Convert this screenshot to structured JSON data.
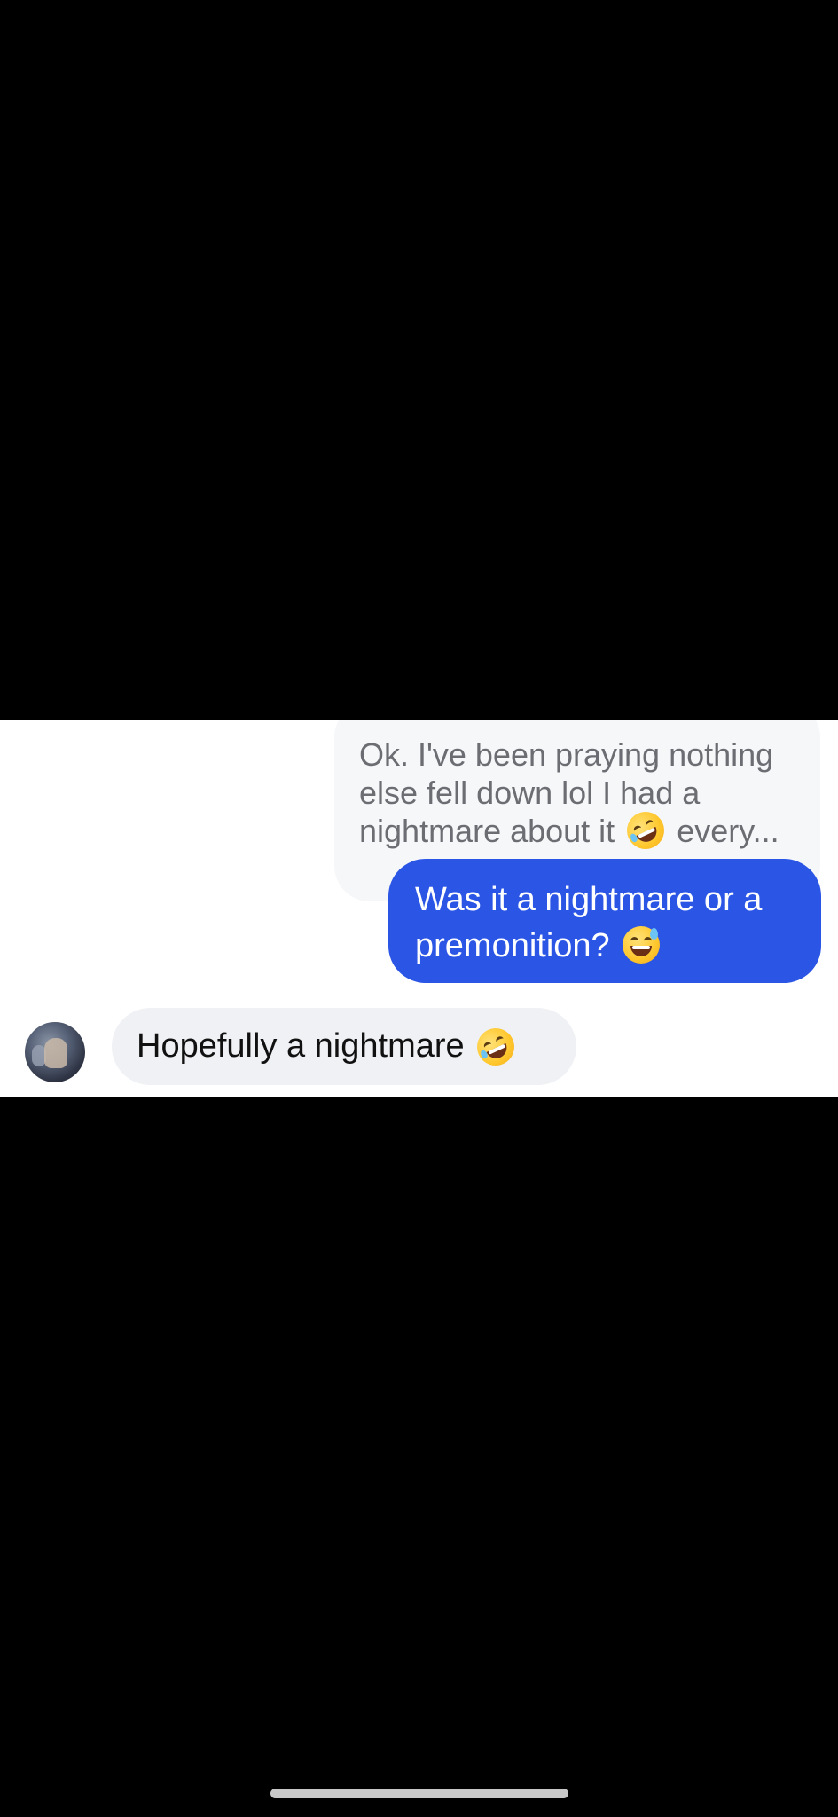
{
  "conversation": {
    "replied_message": {
      "line1": "Ok. I've been praying nothing",
      "line2": "else fell down lol I had a",
      "line3_before_emoji": "nightmare about it",
      "line3_emoji": "rolling-on-floor-laughing-emoji",
      "line3_after_emoji": "every..."
    },
    "outgoing_message": {
      "line1": "Was it a nightmare or a",
      "line2_before_emoji": "premonition?",
      "line2_emoji": "grinning-sweat-emoji"
    },
    "incoming_message": {
      "text": "Hopefully a nightmare",
      "emoji": "rolling-on-floor-laughing-emoji"
    }
  },
  "colors": {
    "outgoing_bubble": "#2a55e5",
    "incoming_bubble": "#f0f1f4",
    "replied_bubble": "#f6f7f9",
    "background_outside": "#000000",
    "chat_background": "#ffffff"
  }
}
